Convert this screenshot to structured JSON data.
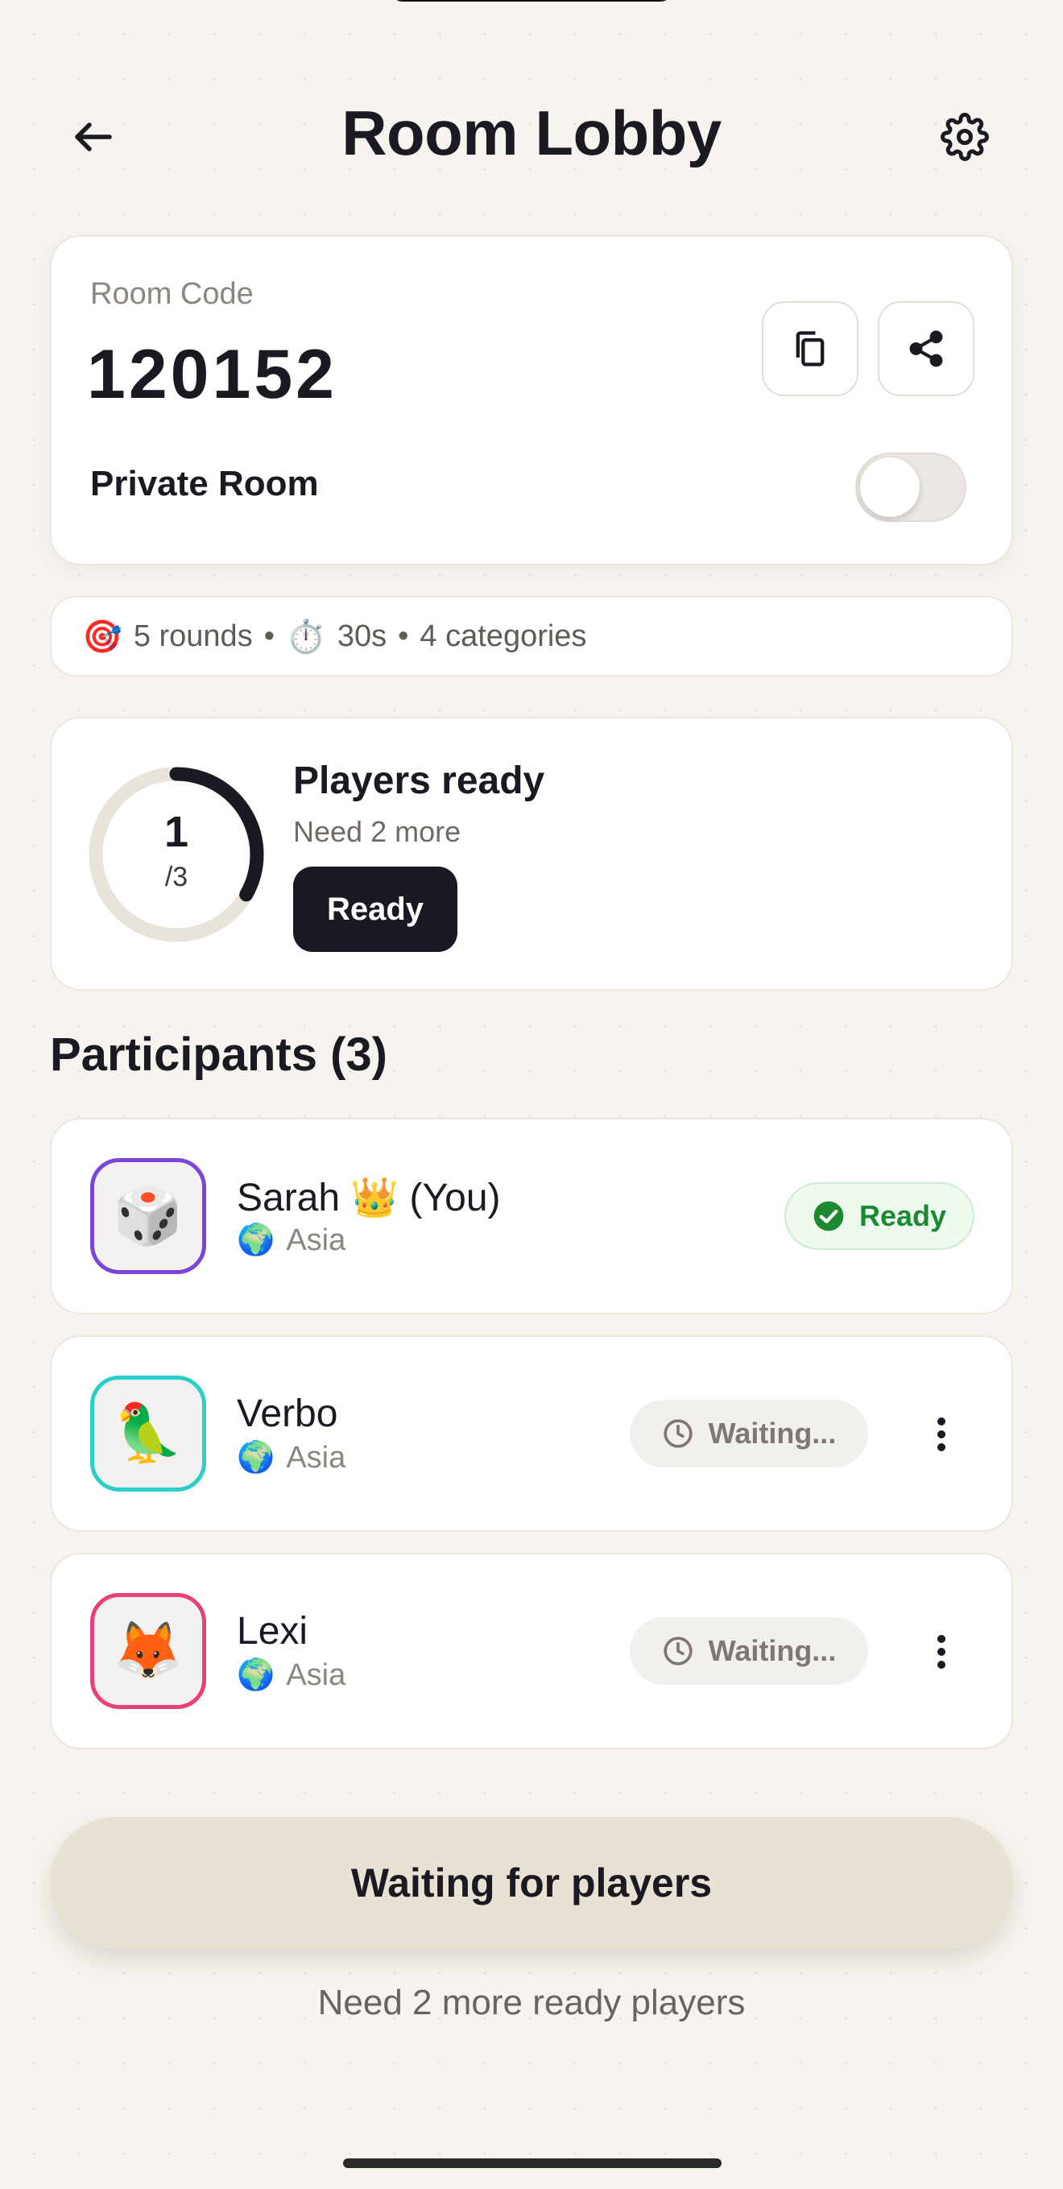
{
  "header": {
    "title": "Room Lobby",
    "back_icon": "arrow-left-icon",
    "settings_icon": "gear-icon"
  },
  "room": {
    "label": "Room Code",
    "code": "120152",
    "private_label": "Private Room",
    "private_enabled": false,
    "copy_icon": "copy-icon",
    "share_icon": "share-icon"
  },
  "game_settings": {
    "rounds_icon": "🎯",
    "rounds": "5 rounds",
    "sep1": "•",
    "timer_icon": "⏱️",
    "time": "30s",
    "sep2": "•",
    "categories": "4 categories"
  },
  "ready_status": {
    "count": "1",
    "total": "/3",
    "ready_fraction": 0.333,
    "title": "Players ready",
    "subtitle": "Need 2 more",
    "button_label": "Ready"
  },
  "participants": {
    "title": "Participants (3)",
    "items": [
      {
        "name": "Sarah 👑 (You)",
        "avatar": "🎲",
        "globe": "🌍",
        "region": "Asia",
        "status": "Ready",
        "border_color": "#7b45d9"
      },
      {
        "name": "Verbo",
        "avatar": "🦜",
        "globe": "🌍",
        "region": "Asia",
        "status": "Waiting...",
        "border_color": "#2ccfc8"
      },
      {
        "name": "Lexi",
        "avatar": "🦊",
        "globe": "🌍",
        "region": "Asia",
        "status": "Waiting...",
        "border_color": "#e8407a"
      }
    ]
  },
  "footer": {
    "button_label": "Waiting for players",
    "hint": "Need 2 more ready players"
  },
  "colors": {
    "background": "#f7f4ef",
    "primary": "#1a1822",
    "ready_green": "#1c8a33",
    "ring_track": "#e8e4da"
  }
}
